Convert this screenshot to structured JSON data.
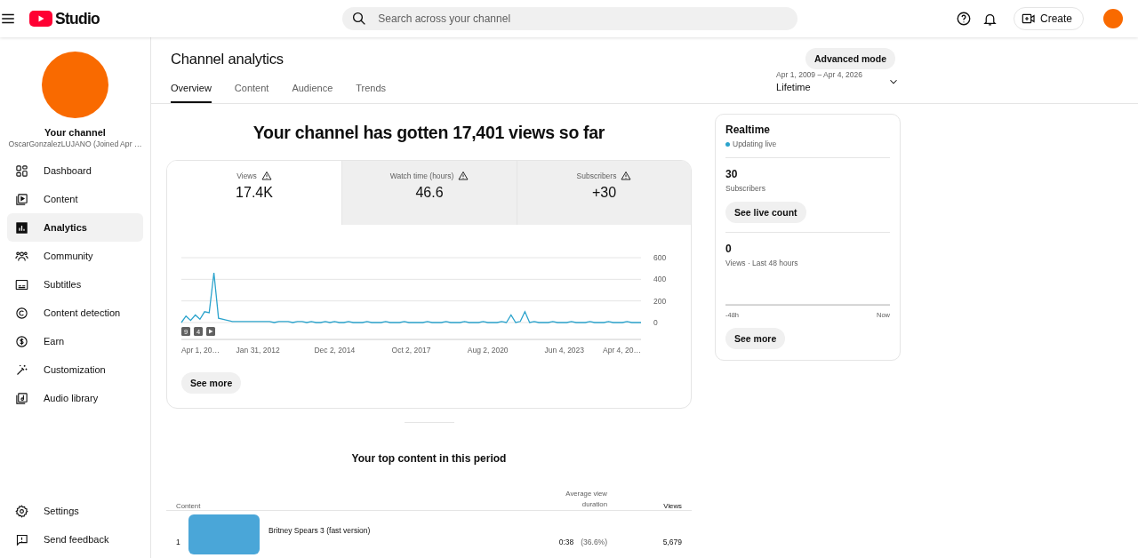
{
  "header": {
    "logo_text": "Studio",
    "search": {
      "placeholder": "Search across your channel"
    },
    "create_label": "Create"
  },
  "sidebar": {
    "channel_title": "Your channel",
    "channel_subtitle": "OscarGonzalezLUJANO (Joined Apr …",
    "items": [
      {
        "label": "Dashboard",
        "kind": "dashboard",
        "selected": false
      },
      {
        "label": "Content",
        "kind": "content",
        "selected": false
      },
      {
        "label": "Analytics",
        "kind": "analytics",
        "selected": true
      },
      {
        "label": "Community",
        "kind": "community",
        "selected": false
      },
      {
        "label": "Subtitles",
        "kind": "subtitles",
        "selected": false
      },
      {
        "label": "Content detection",
        "kind": "detection",
        "selected": false
      },
      {
        "label": "Earn",
        "kind": "earn",
        "selected": false
      },
      {
        "label": "Customization",
        "kind": "customization",
        "selected": false
      },
      {
        "label": "Audio library",
        "kind": "audio",
        "selected": false
      }
    ],
    "footer_items": [
      {
        "label": "Settings",
        "kind": "settings",
        "selected": false
      },
      {
        "label": "Send feedback",
        "kind": "feedback",
        "selected": false
      }
    ]
  },
  "page": {
    "title": "Channel analytics",
    "advanced_button": "Advanced mode",
    "tabs": [
      {
        "label": "Overview",
        "selected": true
      },
      {
        "label": "Content",
        "selected": false
      },
      {
        "label": "Audience",
        "selected": false
      },
      {
        "label": "Trends",
        "selected": false
      }
    ],
    "date_range": {
      "dates": "Apr 1, 2009 – Apr 4, 2026",
      "label": "Lifetime"
    }
  },
  "overview": {
    "headline": "Your channel has gotten 17,401 views so far",
    "metrics": [
      {
        "label": "Views",
        "value": "17.4K",
        "warning": true,
        "selected": true
      },
      {
        "label": "Watch time (hours)",
        "value": "46.6",
        "warning": true,
        "selected": false
      },
      {
        "label": "Subscribers",
        "value": "+30",
        "warning": true,
        "selected": false
      }
    ],
    "chart": {
      "markers": [
        "9",
        "4"
      ],
      "x_axis_labels": [
        "Apr 1, 20…",
        "Jan 31, 2012",
        "Dec 2, 2014",
        "Oct 2, 2017",
        "Aug 2, 2020",
        "Jun 4, 2023",
        "Apr 4, 20…"
      ],
      "chart_data": {
        "type": "line",
        "ylim": [
          0,
          600
        ],
        "yticks": [
          0,
          200,
          400,
          600
        ],
        "series": [
          {
            "color": "#2ba3cc",
            "values": [
              0,
              60,
              20,
              70,
              30,
              100,
              90,
              460,
              40,
              30,
              20,
              10,
              10,
              10,
              10,
              10,
              10,
              10,
              10,
              10,
              0,
              10,
              10,
              10,
              0,
              10,
              10,
              0,
              10,
              0,
              0,
              10,
              0,
              10,
              0,
              0,
              10,
              0,
              0,
              0,
              10,
              0,
              0,
              0,
              10,
              0,
              0,
              0,
              10,
              0,
              0,
              0,
              0,
              10,
              0,
              0,
              0,
              10,
              0,
              0,
              0,
              10,
              0,
              0,
              0,
              10,
              0,
              0,
              0,
              10,
              0,
              70,
              0,
              10,
              100,
              0,
              10,
              0,
              0,
              0,
              10,
              0,
              0,
              0,
              10,
              0,
              0,
              0,
              10,
              0,
              0,
              0,
              10,
              0,
              0,
              0,
              10,
              0,
              0,
              0
            ]
          }
        ]
      }
    },
    "see_more": "See more"
  },
  "realtime": {
    "title": "Realtime",
    "status": "Updating live",
    "subscribers_value": "30",
    "subscribers_label": "Subscribers",
    "live_count_button": "See live count",
    "views_value": "0",
    "views_label": "Views · Last 48 hours",
    "axis_start": "-48h",
    "axis_end": "Now",
    "see_more": "See more"
  },
  "top_content": {
    "title": "Your top content in this period",
    "columns": [
      {
        "label": "Content",
        "kind": "text"
      },
      {
        "label": "Average view duration",
        "kind": "number"
      },
      {
        "label": "Views",
        "kind": "sorted"
      }
    ],
    "rows": [
      {
        "rank": "1",
        "title": "Britney Spears 3 (fast version)",
        "avg_duration": "0:38",
        "avg_percent": "(36.6%)",
        "views": "5,679"
      }
    ]
  }
}
